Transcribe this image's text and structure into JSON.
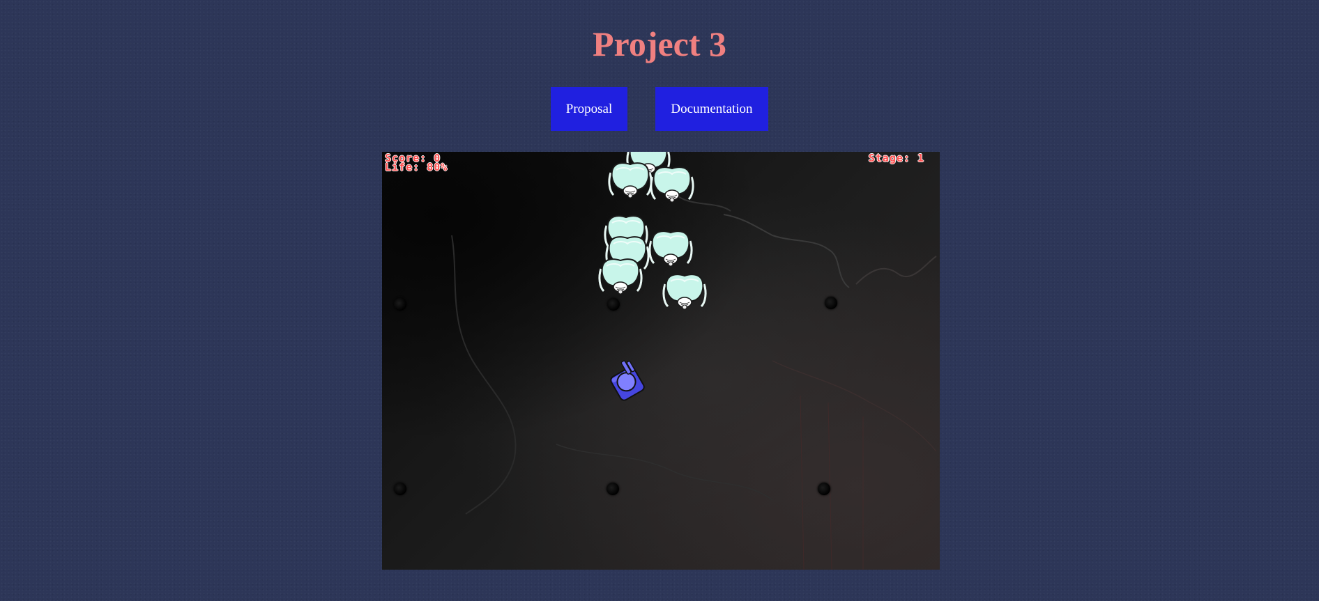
{
  "header": {
    "title": "Project 3"
  },
  "nav": {
    "proposal_label": "Proposal",
    "documentation_label": "Documentation"
  },
  "game": {
    "hud": {
      "score_text": "Score: 0",
      "life_text": "Life: 80%",
      "stage_text": "Stage: 1"
    },
    "enemy_icon": "alien-bug-icon",
    "player_icon": "tank-icon",
    "colors": {
      "hud_text": "#ff5050",
      "enemy_body": "#c8f5ea",
      "player": "#5a5af0"
    }
  },
  "colors": {
    "background": "#2d3658",
    "title": "#f08080",
    "button": "#2020e0"
  }
}
